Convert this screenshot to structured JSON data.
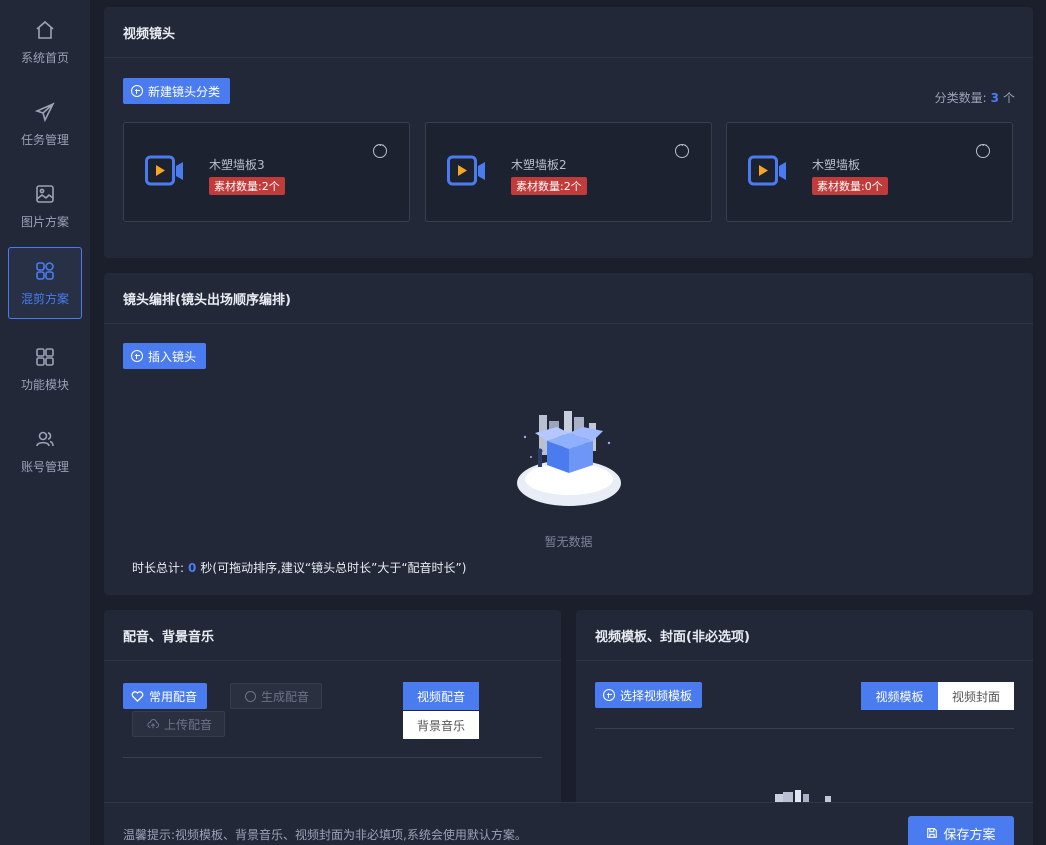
{
  "sidebar": {
    "items": [
      {
        "label": "系统首页",
        "icon": "home-icon"
      },
      {
        "label": "任务管理",
        "icon": "paper-plane-icon"
      },
      {
        "label": "图片方案",
        "icon": "image-icon"
      },
      {
        "label": "混剪方案",
        "icon": "grid-icon",
        "active": true
      },
      {
        "label": "功能模块",
        "icon": "modules-icon"
      },
      {
        "label": "账号管理",
        "icon": "users-icon"
      }
    ]
  },
  "video_shots": {
    "title": "视频镜头",
    "new_button": "新建镜头分类",
    "count_label": "分类数量:",
    "count_value": "3",
    "count_unit": "个",
    "cards": [
      {
        "name": "木塑墙板3",
        "tag": "素材数量:2个"
      },
      {
        "name": "木塑墙板2",
        "tag": "素材数量:2个"
      },
      {
        "name": "木塑墙板",
        "tag": "素材数量:0个"
      }
    ]
  },
  "arrangement": {
    "title": "镜头编排(镜头出场顺序编排)",
    "insert_button": "插入镜头",
    "empty_text": "暂无数据",
    "duration_prefix": "时长总计:",
    "duration_value": "0",
    "duration_suffix": "秒(可拖动排序,建议“镜头总时长”大于“配音时长”)"
  },
  "audio": {
    "title": "配音、背景音乐",
    "common_button": "常用配音",
    "generate_button": "生成配音",
    "upload_button": "上传配音",
    "tab_video_voice": "视频配音",
    "tab_bg_music": "背景音乐"
  },
  "template": {
    "title": "视频模板、封面(非必选项)",
    "select_button": "选择视频模板",
    "tab_template": "视频模板",
    "tab_cover": "视频封面"
  },
  "footer": {
    "tip": "温馨提示:视频模板、背景音乐、视频封面为非必填项,系统会使用默认方案。",
    "save_button": "保存方案"
  },
  "colors": {
    "accent": "#4a7cf0",
    "tag_red": "#c23b3b",
    "background": "#1b1f2b",
    "panel": "#232838"
  }
}
